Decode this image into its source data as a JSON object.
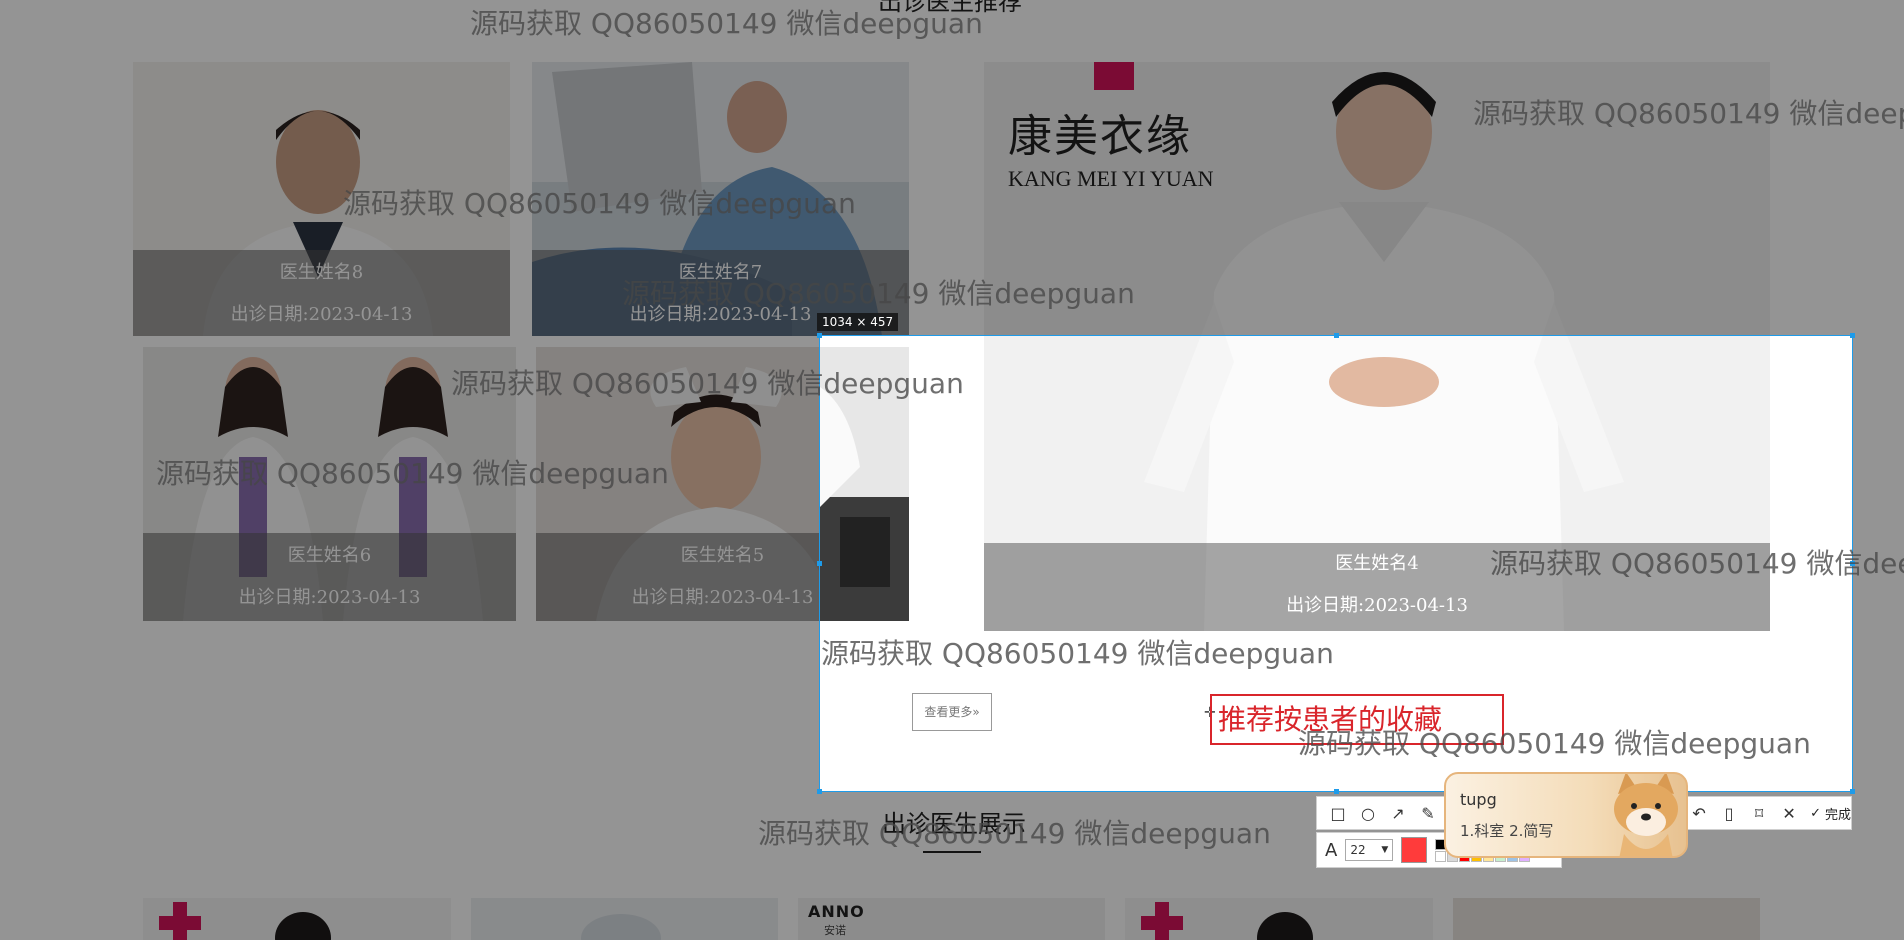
{
  "page": {
    "top_cut_title": "出诊医生推荐"
  },
  "doctor_cards": [
    {
      "name": "医生姓名8",
      "date": "出诊日期:2023-04-13"
    },
    {
      "name": "医生姓名7",
      "date": "出诊日期:2023-04-13"
    },
    {
      "name": "医生姓名6",
      "date": "出诊日期:2023-04-13"
    },
    {
      "name": "医生姓名5",
      "date": "出诊日期:2023-04-13"
    },
    {
      "name": "医生姓名4",
      "date": "出诊日期:2023-04-13"
    }
  ],
  "featured_brand": {
    "logo_cn": "康美衣缘",
    "logo_en": "KANG MEI YI YUAN"
  },
  "more_button": "查看更多»",
  "section_title": "出诊医生展示",
  "bottom_thumbs": [
    {
      "brand": "ANNO",
      "sub": "安诺"
    }
  ],
  "screenshot_tool": {
    "size_label": "1034 × 457",
    "annotation_text": "推荐按患者的收藏",
    "font_size": "22",
    "done_label": "完成",
    "current_color": "#ff3b3b",
    "palette": [
      "#000000",
      "#7f7f7f",
      "#c00000",
      "#f79646",
      "#ffff00",
      "#92d050",
      "#00b0f0",
      "#7030a0",
      "#ffffff",
      "#d9d9d9",
      "#ff0000",
      "#ffc000",
      "#ffe699",
      "#c6efce",
      "#9dc3e6",
      "#e0b0ff"
    ]
  },
  "ime": {
    "composition": "tupg",
    "candidates": "1.科室  2.简写"
  },
  "watermark_text": "源码获取 QQ86050149 微信deepguan"
}
